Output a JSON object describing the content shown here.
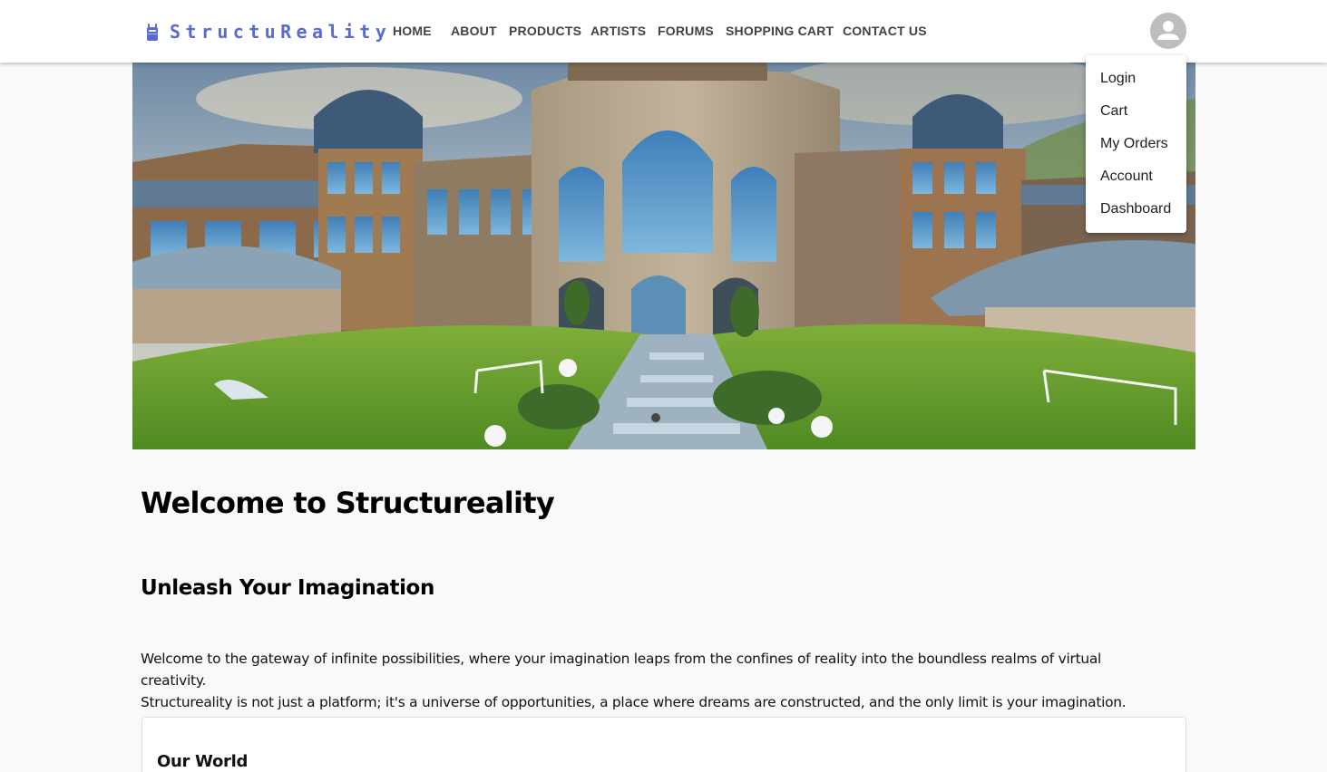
{
  "brand": {
    "name": "StructuReality",
    "icon": "robot-icon",
    "color": "#5a6bd0"
  },
  "nav": {
    "items": [
      "HOME",
      "ABOUT",
      "PRODUCTS",
      "ARTISTS",
      "FORUMS",
      "SHOPPING CART",
      "CONTACT US"
    ]
  },
  "account": {
    "icon": "account-circle-icon",
    "menu": [
      "Login",
      "Cart",
      "My Orders",
      "Account",
      "Dashboard"
    ]
  },
  "hero": {
    "image": "campus-buildings-with-lawn-and-soccer-goals",
    "indicator_count": 1
  },
  "content": {
    "title": "Welcome to Structureality",
    "subtitle": "Unleash Your Imagination",
    "intro_line1": "Welcome to the gateway of infinite possibilities, where your imagination leaps from the confines of reality into the boundless realms of virtual creativity.",
    "intro_line2": "Structureality is not just a platform; it's a universe of opportunities, a place where dreams are constructed, and the only limit is your imagination.",
    "card_title": "Our World"
  }
}
